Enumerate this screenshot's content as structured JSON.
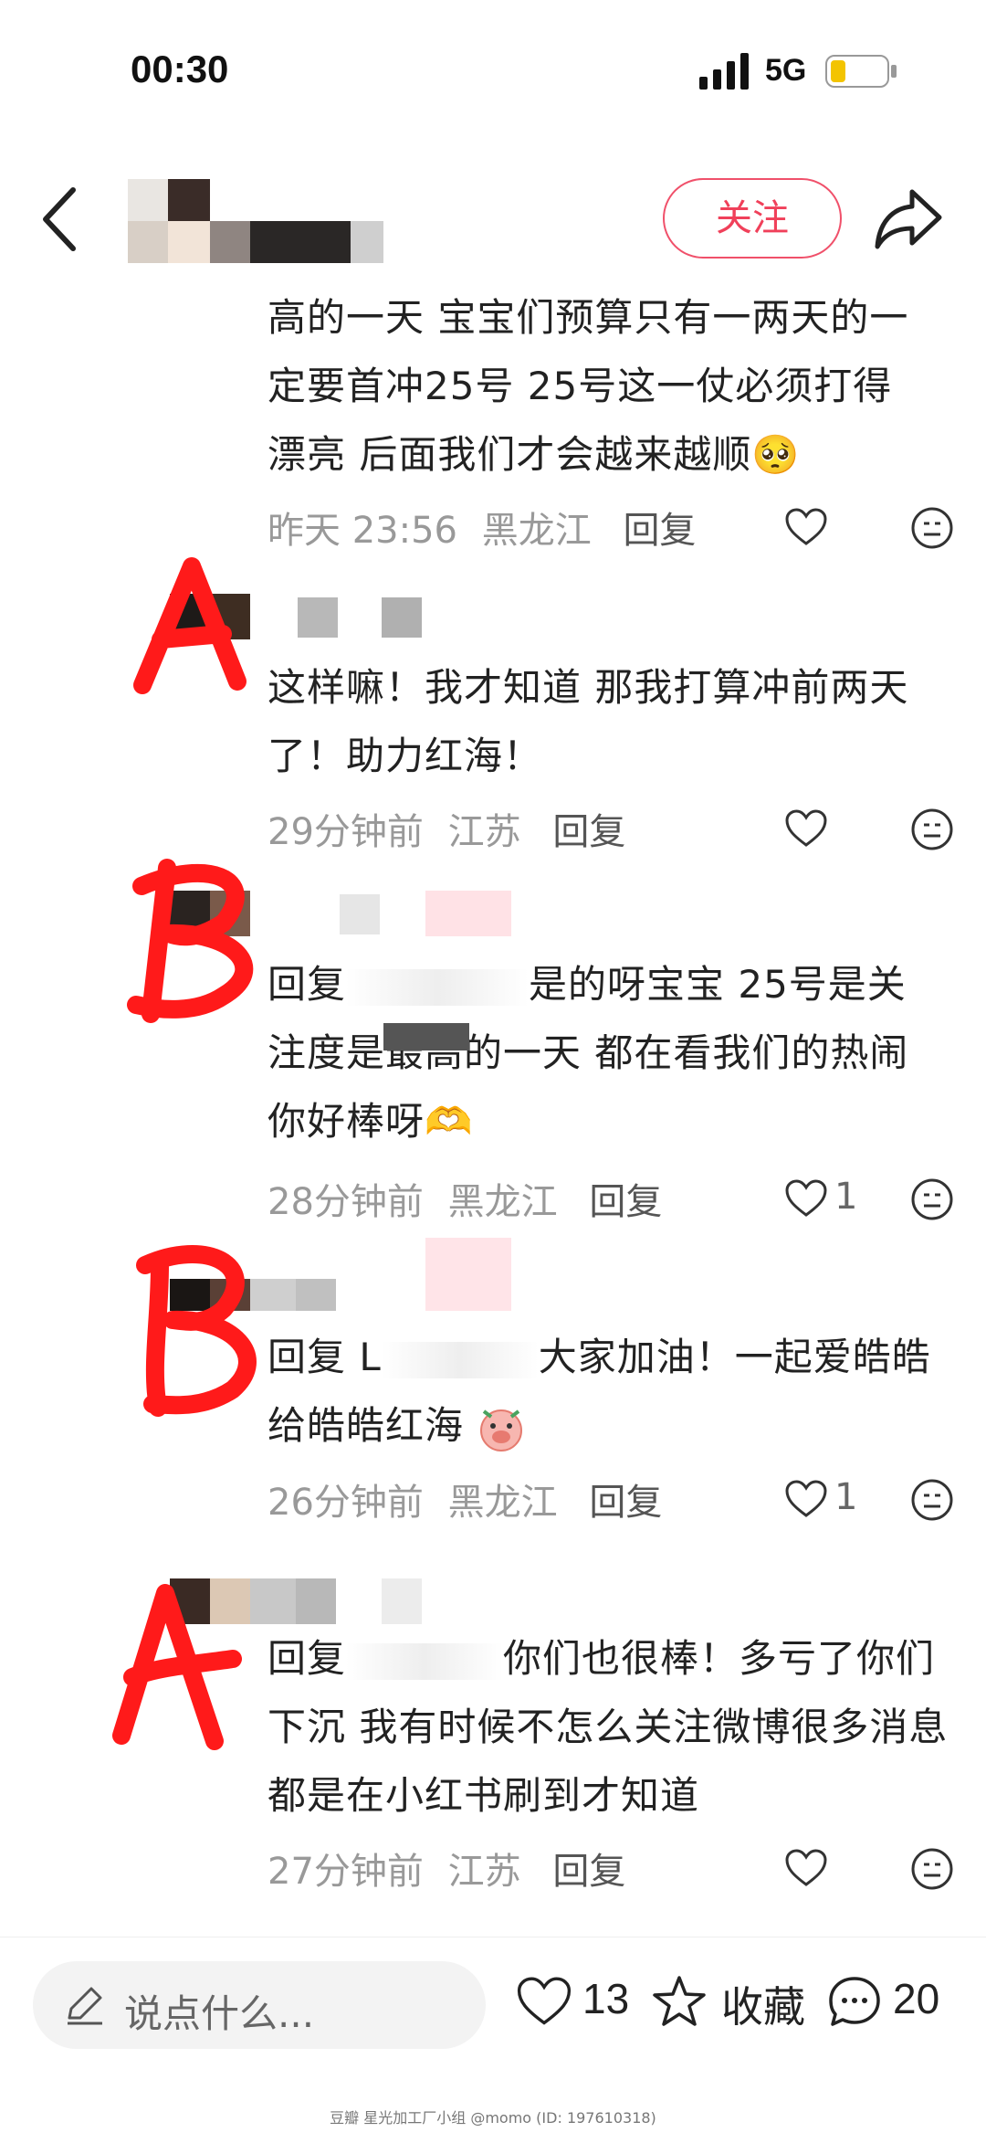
{
  "status_bar": {
    "time": "00:30",
    "network": "5G"
  },
  "header": {
    "follow_label": "关注"
  },
  "comments": [
    {
      "text": "高的一天 宝宝们预算只有一两天的一定要首冲25号 25号这一仗必须打得漂亮 后面我们才会越来越顺🥺",
      "time": "昨天 23:56",
      "location": "黑龙江",
      "reply": "回复",
      "likes": ""
    },
    {
      "text": "这样嘛！我才知道 那我打算冲前两天了！助力红海！",
      "time": "29分钟前",
      "location": "江苏",
      "reply": "回复",
      "likes": ""
    },
    {
      "prefix": "回复",
      "text": "是的呀宝宝 25号是关注度是最高的一天 都在看我们的热闹 你好棒呀🫶",
      "time": "28分钟前",
      "location": "黑龙江",
      "reply": "回复",
      "likes": "1"
    },
    {
      "prefix": "回复 L",
      "text": "大家加油！一起爱皓皓给皓皓红海",
      "time": "26分钟前",
      "location": "黑龙江",
      "reply": "回复",
      "likes": "1"
    },
    {
      "prefix": "回复",
      "text": "你们也很棒！多亏了你们下沉 我有时候不怎么关注微博很多消息都是在小红书刷到才知道",
      "time": "27分钟前",
      "location": "江苏",
      "reply": "回复",
      "likes": ""
    }
  ],
  "bottom_bar": {
    "input_placeholder": "说点什么...",
    "like_count": "13",
    "collect_label": "收藏",
    "comment_count": "20"
  },
  "annotations": [
    "A",
    "B",
    "B",
    "A"
  ],
  "watermark": "豆瓣  星光加工厂小组 @momo (ID: 197610318)",
  "colors": {
    "accent": "#f0405a",
    "annotation": "#ff1a1a"
  }
}
